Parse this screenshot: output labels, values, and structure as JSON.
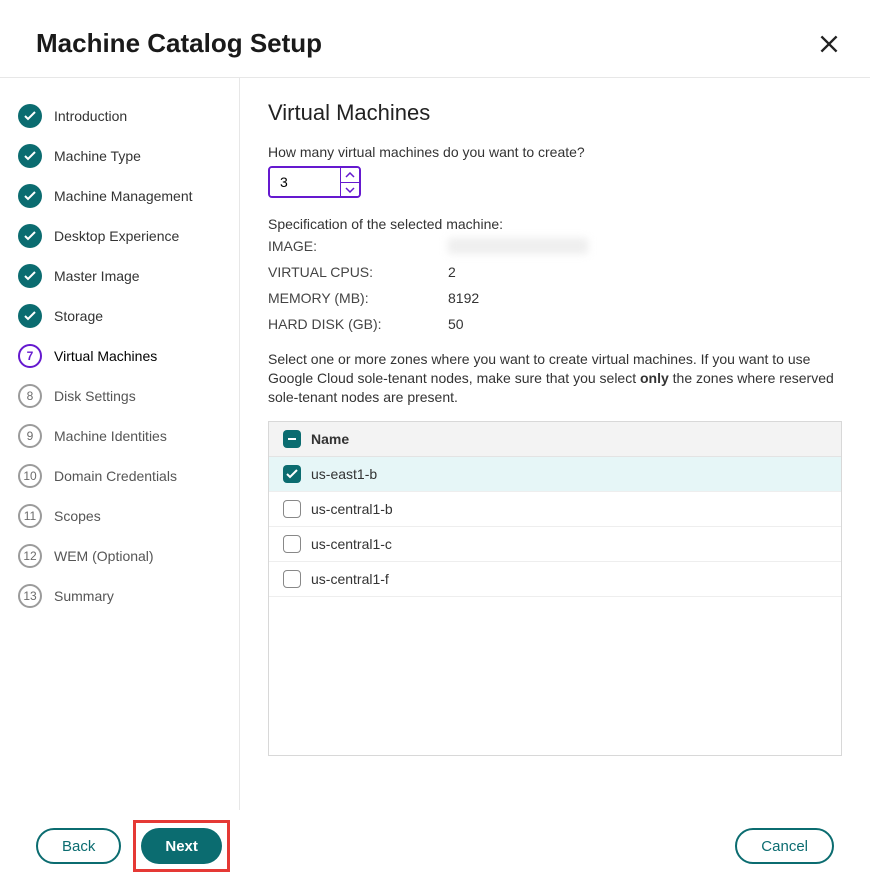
{
  "header": {
    "title": "Machine Catalog Setup"
  },
  "sidebar": {
    "items": [
      {
        "label": "Introduction",
        "state": "done"
      },
      {
        "label": "Machine Type",
        "state": "done"
      },
      {
        "label": "Machine Management",
        "state": "done"
      },
      {
        "label": "Desktop Experience",
        "state": "done"
      },
      {
        "label": "Master Image",
        "state": "done"
      },
      {
        "label": "Storage",
        "state": "done"
      },
      {
        "label": "Virtual Machines",
        "state": "current",
        "num": "7"
      },
      {
        "label": "Disk Settings",
        "state": "pending",
        "num": "8"
      },
      {
        "label": "Machine Identities",
        "state": "pending",
        "num": "9"
      },
      {
        "label": "Domain Credentials",
        "state": "pending",
        "num": "10"
      },
      {
        "label": "Scopes",
        "state": "pending",
        "num": "11"
      },
      {
        "label": "WEM (Optional)",
        "state": "pending",
        "num": "12"
      },
      {
        "label": "Summary",
        "state": "pending",
        "num": "13"
      }
    ]
  },
  "main": {
    "heading": "Virtual Machines",
    "question": "How many virtual machines do you want to create?",
    "count": "3",
    "spec_heading": "Specification of the selected machine:",
    "specs": {
      "image_key": "IMAGE:",
      "image_val": "",
      "vcpu_key": "VIRTUAL CPUS:",
      "vcpu_val": "2",
      "mem_key": "MEMORY (MB):",
      "mem_val": "8192",
      "disk_key": "HARD DISK (GB):",
      "disk_val": "50"
    },
    "instructions_pre": "Select one or more zones where you want to create virtual machines. If you want to use Google Cloud sole-tenant nodes, make sure that you select ",
    "instructions_bold": "only",
    "instructions_post": " the zones where reserved sole-tenant nodes are present.",
    "zone_header": "Name",
    "zones": [
      {
        "name": "us-east1-b",
        "checked": true
      },
      {
        "name": "us-central1-b",
        "checked": false
      },
      {
        "name": "us-central1-c",
        "checked": false
      },
      {
        "name": "us-central1-f",
        "checked": false
      }
    ]
  },
  "footer": {
    "back": "Back",
    "next": "Next",
    "cancel": "Cancel"
  }
}
